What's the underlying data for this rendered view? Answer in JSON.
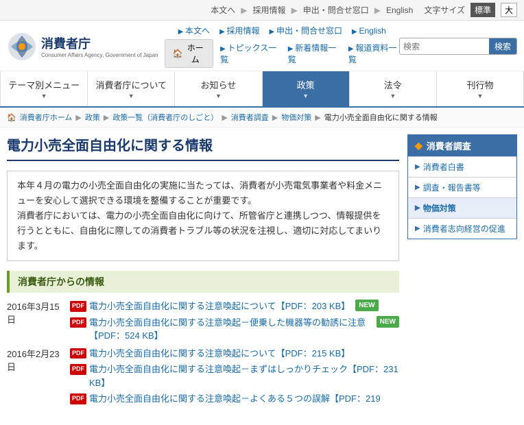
{
  "topbar": {
    "links": [
      {
        "label": "本文へ",
        "id": "main-content-link"
      },
      {
        "label": "採用情報",
        "id": "recruit-link"
      },
      {
        "label": "申出・問合せ窓口",
        "id": "contact-link"
      },
      {
        "label": "English",
        "id": "english-link"
      }
    ],
    "font_size_label": "文字サイズ",
    "font_standard": "標準",
    "font_large": "大"
  },
  "header": {
    "logo_ja": "消費者庁",
    "logo_en": "Consumer Affairs Agency, Government of Japan",
    "home_btn": "ホーム",
    "nav_links_top": [
      {
        "label": "本文へ"
      },
      {
        "label": "採用情報"
      },
      {
        "label": "申出・問合せ窓口"
      },
      {
        "label": "English"
      }
    ],
    "nav_links_bottom": [
      {
        "label": "トピックス一覧"
      },
      {
        "label": "新着情報一覧"
      },
      {
        "label": "報道資料一覧"
      }
    ],
    "search_placeholder": "検索",
    "search_btn": "検索"
  },
  "nav": {
    "items": [
      {
        "label": "テーマ別メニュー",
        "active": false
      },
      {
        "label": "消費者庁について",
        "active": false
      },
      {
        "label": "お知らせ",
        "active": false
      },
      {
        "label": "政策",
        "active": true
      },
      {
        "label": "法令",
        "active": false
      },
      {
        "label": "刊行物",
        "active": false
      }
    ]
  },
  "breadcrumb": {
    "items": [
      {
        "label": "消費者庁ホーム",
        "link": true
      },
      {
        "label": "政策",
        "link": true
      },
      {
        "label": "政策一覧（消費者庁のしごと）",
        "link": true
      },
      {
        "label": "消費者調査",
        "link": true
      },
      {
        "label": "物価対策",
        "link": true
      },
      {
        "label": "電力小売全面自由化に関する情報",
        "link": false
      }
    ]
  },
  "page": {
    "title": "電力小売全面自由化に関する情報",
    "intro": "本年４月の電力の小売全面自由化の実施に当たっては、消費者が小売電気事業者や料金メニューを安心して選択できる環境を整備することが重要です。\n消費者庁においては、電力の小売全面自由化に向けて、所管省庁と連携しつつ、情報提供を行うとともに、自由化に際しての消費者トラブル等の状況を注視し、適切に対応してまいります。",
    "section_title": "消費者庁からの情報",
    "news": [
      {
        "date": "2016年3月15日",
        "items": [
          {
            "text": "電力小売全面自由化に関する注意喚起について【PDF：203 KB】",
            "new": true,
            "pdf": true
          },
          {
            "text": "電力小売全面自由化に関する注意喚起－便乗した機器等の勧誘に注意【PDF：524 KB】",
            "new": true,
            "pdf": true
          }
        ]
      },
      {
        "date": "2016年2月23日",
        "items": [
          {
            "text": "電力小売全面自由化に関する注意喚起について【PDF：215 KB】",
            "new": false,
            "pdf": true
          },
          {
            "text": "電力小売全面自由化に関する注意喚起－まずはしっかりチェック【PDF：231 KB】",
            "new": false,
            "pdf": true
          },
          {
            "text": "電力小売全面自由化に関する注意喚起－よくある５つの誤解【PDF：219",
            "new": false,
            "pdf": true
          }
        ]
      }
    ]
  },
  "sidebar": {
    "section_title": "消費者調査",
    "items": [
      {
        "label": "消費者白書",
        "active": false
      },
      {
        "label": "調査・報告書等",
        "active": false
      },
      {
        "label": "物価対策",
        "active": true
      },
      {
        "label": "消費者志向経営の促進",
        "active": false
      }
    ]
  },
  "icons": {
    "pdf": "PDF",
    "new": "NEW",
    "home": "🏠",
    "arrow_right": "▶",
    "bullet_orange": "◆"
  }
}
